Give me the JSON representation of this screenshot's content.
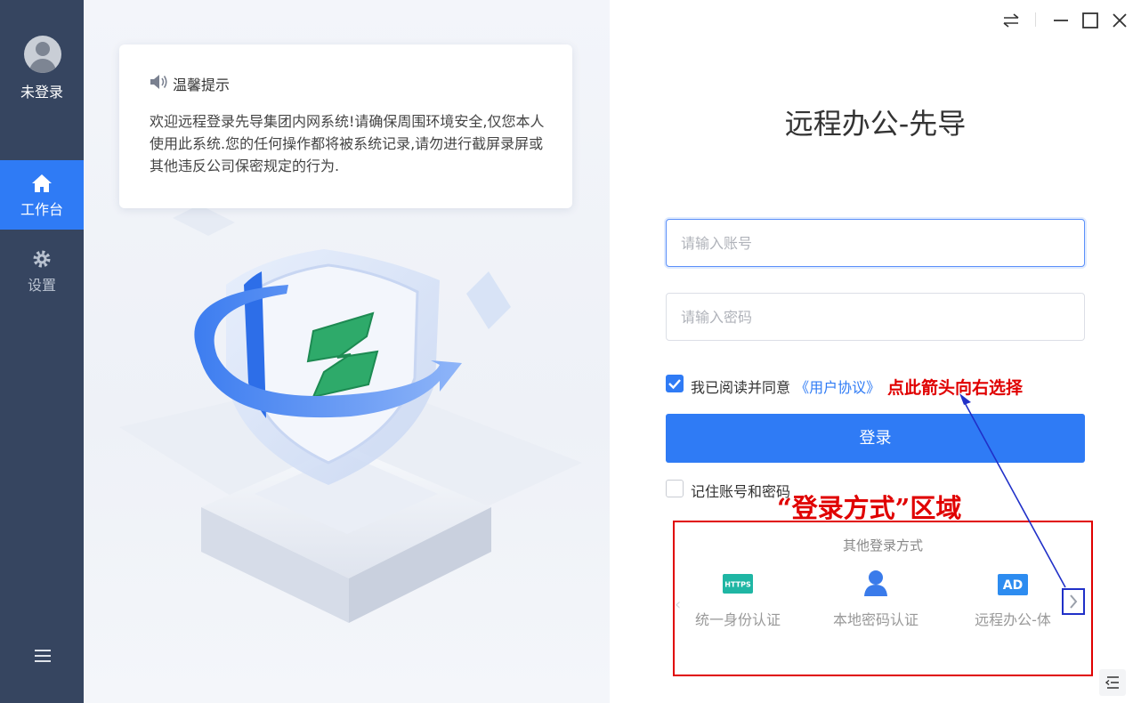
{
  "sidebar": {
    "user_label": "未登录",
    "items": [
      {
        "label": "工作台",
        "icon": "home-icon",
        "active": true
      },
      {
        "label": "设置",
        "icon": "gear-icon",
        "active": false
      }
    ],
    "bottom_icon": "menu-icon"
  },
  "notice": {
    "title": "温馨提示",
    "icon": "speaker-icon",
    "text": "欢迎远程登录先导集团内网系统!请确保周围环境安全,仅您本人使用此系统.您的任何操作都将被系统记录,请勿进行截屏录屏或其他违反公司保密规定的行为."
  },
  "window_controls": [
    "switch-icon",
    "minimize-icon",
    "maximize-icon",
    "close-icon"
  ],
  "login": {
    "title": "远程办公-先导",
    "account_placeholder": "请输入账号",
    "password_placeholder": "请输入密码",
    "agree_text": "我已阅读并同意",
    "agree_link": "《用户协议》",
    "agree_checked": true,
    "login_button": "登录",
    "remember_text": "记住账号和密码",
    "remember_checked": false
  },
  "annotations": {
    "arrow_hint": "点此箭头向右选择",
    "region_label": "“登录方式”区域"
  },
  "other_methods": {
    "title": "其他登录方式",
    "items": [
      {
        "label": "统一身份认证",
        "icon": "https-icon",
        "icon_text": "HTTPS"
      },
      {
        "label": "本地密码认证",
        "icon": "user-icon"
      },
      {
        "label": "远程办公-体",
        "icon": "ad-icon",
        "icon_text": "AD"
      }
    ]
  },
  "colors": {
    "sidebar_bg": "#364560",
    "accent": "#2f7bf5",
    "annotation_red": "#e00000",
    "annotation_blue": "#2030c8"
  }
}
